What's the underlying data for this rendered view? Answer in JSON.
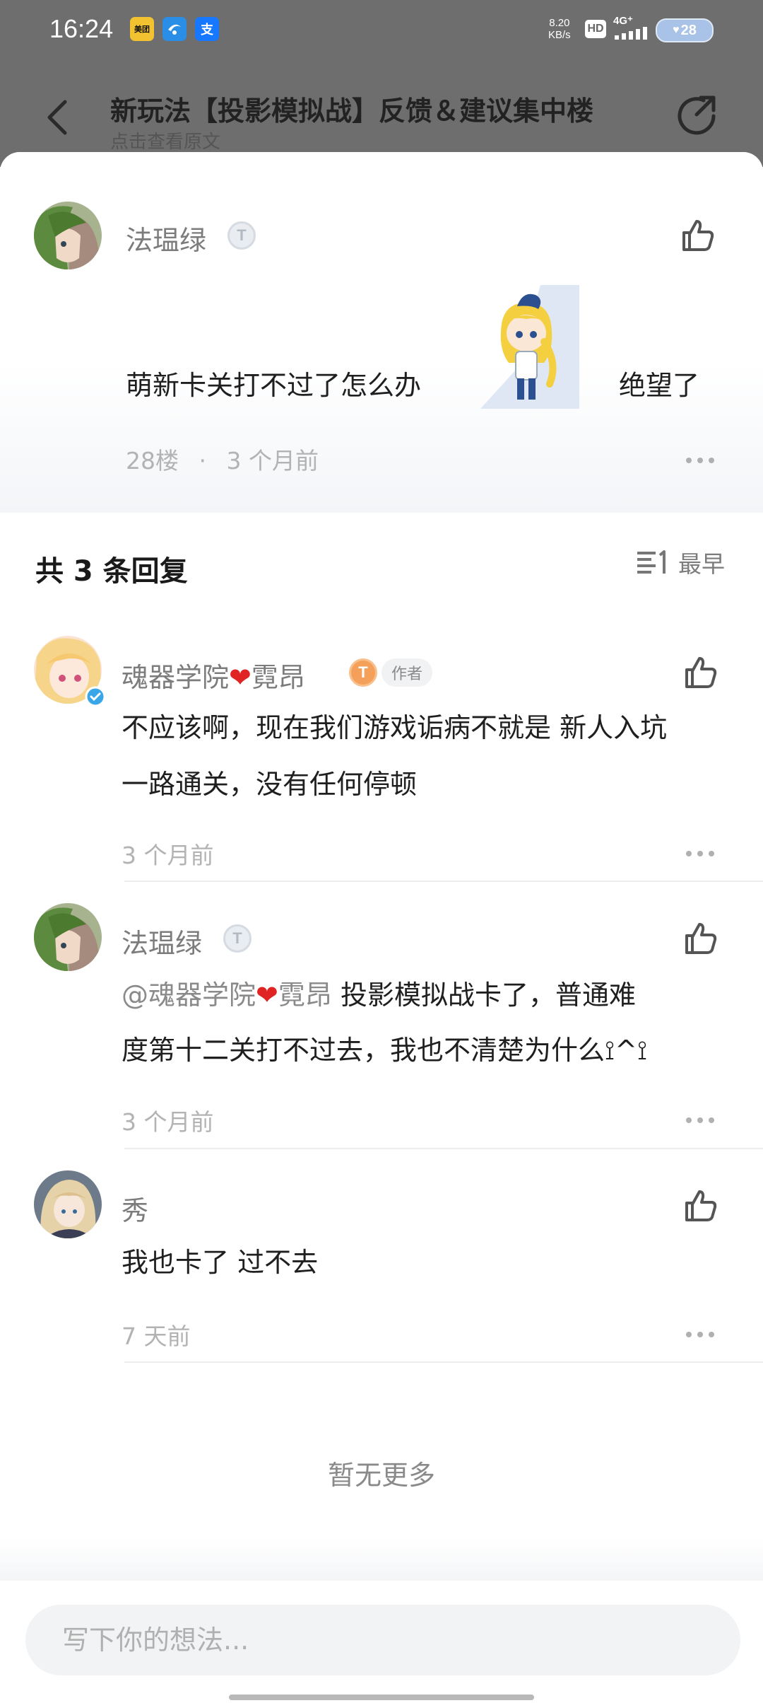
{
  "status_bar": {
    "time": "16:24",
    "app_badges": [
      "美团",
      "电信",
      "支付宝"
    ],
    "net_speed_value": "8.20",
    "net_speed_unit": "KB/s",
    "hd_label": "HD",
    "network": "4G⁺",
    "battery": "28"
  },
  "nav": {
    "title": "新玩法【投影模拟战】反馈＆建议集中楼",
    "subtitle": "点击查看原文"
  },
  "original_post": {
    "username": "法瑥绿",
    "level": "T",
    "text_before": "萌新卡关打不过了怎么办",
    "text_after": "绝望了",
    "floor": "28楼",
    "separator": "·",
    "time": "3 个月前"
  },
  "replies_section": {
    "title": "共 3 条回复",
    "sort_label": "最早"
  },
  "replies": [
    {
      "username_prefix": "魂器学院",
      "username_suffix": "霓昂",
      "level": "T",
      "author_tag": "作者",
      "line1": "不应该啊，现在我们游戏诟病不就是 新人入坑",
      "line2": "一路通关，没有任何停顿",
      "time": "3 个月前"
    },
    {
      "username": "法瑥绿",
      "level": "T",
      "mention_prefix": "@魂器学院",
      "mention_suffix": "霓昂",
      "line1_rest": "  投影模拟战卡了，普通难",
      "line2": "度第十二关打不过去，我也不清楚为什么⟟^⟟",
      "time": "3 个月前"
    },
    {
      "username": "秀",
      "line1": "我也卡了 过不去",
      "time": "7 天前"
    }
  ],
  "footer": {
    "no_more": "暂无更多",
    "input_placeholder": "写下你的想法..."
  },
  "colors": {
    "accent_orange": "#f5a05a",
    "heart_red": "#e02424",
    "verified_blue": "#3aa6e8"
  }
}
